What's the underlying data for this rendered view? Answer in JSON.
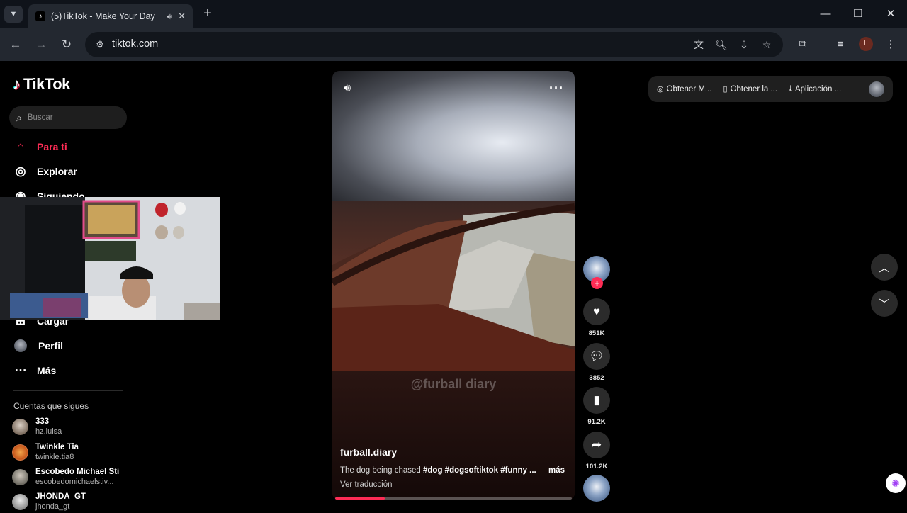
{
  "browser": {
    "tab_title": "(5)TikTok - Make Your Day",
    "url": "tiktok.com",
    "profile_initial": "L"
  },
  "sidebar": {
    "logo": "TikTok",
    "search_placeholder": "Buscar",
    "nav": [
      {
        "label": "Para ti",
        "icon": "home-icon"
      },
      {
        "label": "Explorar",
        "icon": "compass-icon"
      },
      {
        "label": "Siguiendo",
        "icon": "following-icon"
      },
      {
        "label": "Cargar",
        "icon": "upload-icon"
      },
      {
        "label": "Perfil",
        "icon": "profile-icon"
      },
      {
        "label": "Más",
        "icon": "more-icon"
      }
    ],
    "following_header": "Cuentas que sigues",
    "accounts": [
      {
        "name": "333",
        "handle": "hz.luisa"
      },
      {
        "name": "Twinkle Tia",
        "handle": "twinkle.tia8"
      },
      {
        "name": "Escobedo Michael Sti",
        "handle": "escobedomichaelstiv..."
      },
      {
        "name": "JHONDA_GT",
        "handle": "jhonda_gt"
      }
    ]
  },
  "video": {
    "watermark": "@furball diary",
    "author": "furball.diary",
    "description_text": "The dog being chased ",
    "hashtags": "#dog #dogsoftiktok #funny ...",
    "more_label": "más",
    "translate_label": "Ver traducción",
    "progress": 0.21
  },
  "actions": {
    "likes": "851K",
    "comments": "3852",
    "saves": "91.2K",
    "shares": "101.2K"
  },
  "topbar": {
    "item1": "Obtener M...",
    "item2": "Obtener la ...",
    "item3": "Aplicación ..."
  },
  "colors": {
    "accent": "#fe2c55",
    "background": "#000000"
  }
}
